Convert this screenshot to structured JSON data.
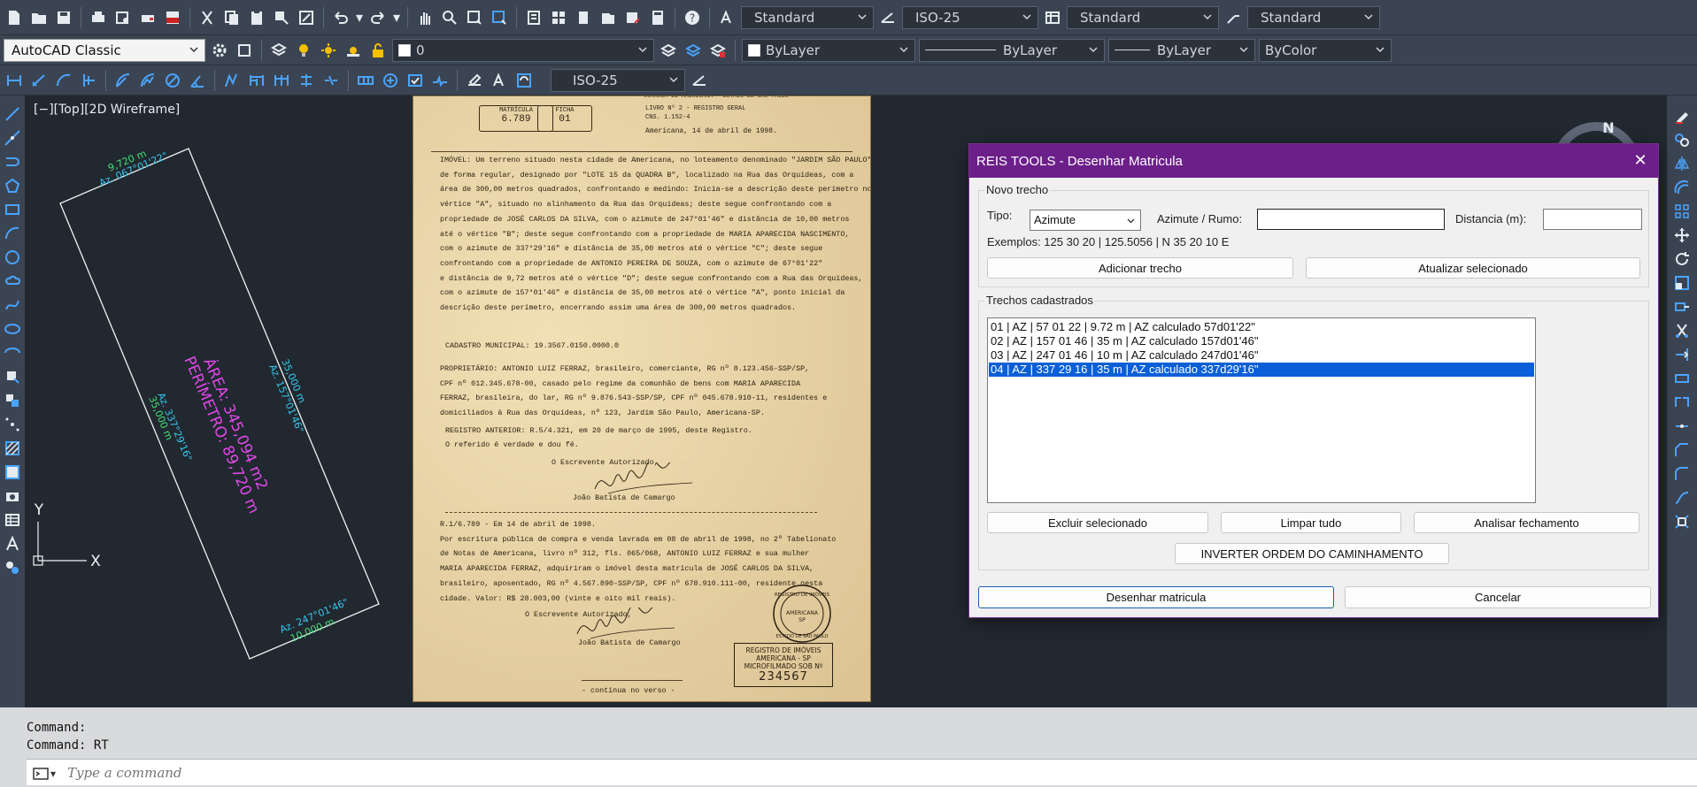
{
  "toolbar1": {
    "text_style": "Standard",
    "dim_style": "ISO-25",
    "table_style": "Standard",
    "multileader_style": "Standard"
  },
  "toolbar2": {
    "workspace": "AutoCAD Classic",
    "layer": "0",
    "color": "ByLayer",
    "linetype": "ByLayer",
    "lineweight": "ByLayer",
    "plotstyle": "ByColor"
  },
  "toolbar3": {
    "dim_style": "ISO-25"
  },
  "viewport": {
    "label": "[−][Top][2D Wireframe]",
    "compass_north": "N",
    "ucs_y": "Y",
    "ucs_x": "X",
    "drawing": {
      "seg1_len": "9,720 m",
      "seg1_az": "Az. 067°01'22\"",
      "seg2_len": "35,000 m",
      "seg2_az": "Az. 157°01'46\"",
      "seg3_len": "10,000 m",
      "seg3_az": "Az. 247°01'46\"",
      "seg4_len": "35,000 m",
      "seg4_az": "Az. 337°29'16\"",
      "area": "ÁREA: 345,094 m2",
      "perimeter": "PERÍMETRO: 89,720 m"
    }
  },
  "document": {
    "matricula_label": "MATRÍCULA",
    "matricula_value": "6.789",
    "ficha_label": "FICHA",
    "ficha_value": "01",
    "header_top": "COMARCA DE AMERICANA — ESTADO DE SÃO PAULO",
    "livro": "LIVRO Nº 2 - REGISTRO GERAL",
    "cns": "CNS. 1.152-4",
    "date": "Americana, 14 de abril de 1998.",
    "body_lines": [
      "IMÓVEL: Um terreno situado nesta cidade de Americana, no loteamento denominado \"JARDIM SÃO PAULO\",",
      "de forma regular, designado por \"LOTE 15 da QUADRA B\", localizado na Rua das Orquídeas, com a",
      "área de 300,00 metros quadrados, confrontando e medindo: Inicia-se a descrição deste perímetro no",
      "vértice \"A\", situado no alinhamento da Rua das Orquídeas; deste segue confrontando com a",
      "propriedade de JOSÉ CARLOS DA SILVA, com o azimute de 247°01'46\" e distância de 10,00 metros",
      "até o vértice \"B\"; deste segue confrontando com a propriedade de MARIA APARECIDA NASCIMENTO,",
      "com o azimute de 337°29'16\" e distância de 35,00 metros até o vértice \"C\"; deste segue",
      "confrontando com a propriedade de ANTONIO PEREIRA DE SOUZA, com o azimute de 67°01'22\"",
      "e distância de 9,72 metros até o vértice \"D\"; deste segue confrontando com a Rua das Orquídeas,",
      "com o azimute de 157°01'46\" e distância de 35,00 metros até o vértice \"A\", ponto inicial da",
      "descrição deste perímetro, encerrando assim uma área de 300,00 metros quadrados."
    ],
    "cadastro": "CADASTRO MUNICIPAL: 19.3567.0150.0000.0",
    "prop_lines": [
      "PROPRIETÁRIO: ANTONIO LUIZ FERRAZ, brasileiro, comerciante, RG nº 8.123.456-SSP/SP,",
      "CPF nº 012.345.678-00, casado pelo regime da comunhão de bens com MARIA APARECIDA",
      "FERRAZ, brasileira, do lar, RG nº 9.876.543-SSP/SP, CPF nº 045.678.910-11, residentes e",
      "domiciliados à Rua das Orquídeas, nº 123, Jardim São Paulo, Americana-SP."
    ],
    "registro_anterior": "REGISTRO ANTERIOR: R.5/4.321, em 20 de março de 1995, deste Registro.",
    "verdade": "O referido é verdade e dou fé.",
    "escrevente1": "O Escrevente Autorizado,",
    "signer1": "João Batista de Camargo",
    "r1_lines": [
      "R.1/6.789 - Em 14 de abril de 1998.",
      "Por escritura pública de compra e venda lavrada em 08 de abril de 1998, no 2º Tabelionato",
      "de Notas de Americana, livro nº 312, fls. 065/068, ANTONIO LUIZ FERRAZ e sua mulher",
      "MARIA APARECIDA FERRAZ, adquiriram o imóvel desta matrícula de JOSÉ CARLOS DA SILVA,",
      "brasileiro, aposentado, RG nº 4.567.890-SSP/SP, CPF nº 678.910.111-00, residente nesta",
      "cidade. Valor: R$ 28.003,00 (vinte e oito mil reais)."
    ],
    "escrevente2": "O Escrevente Autorizado,",
    "signer2": "João Batista de Camargo",
    "continua": "- continua no verso -",
    "seal_lines": [
      "REGISTRO DE IMÓVEIS",
      "AMERICANA",
      "SP",
      "ESTADO DE SÃO PAULO"
    ],
    "stamp_lines": [
      "REGISTRO DE IMÓVEIS",
      "AMERICANA - SP",
      "MICROFILMADO SOB Nº",
      "234567"
    ]
  },
  "dialog": {
    "title": "REIS TOOLS - Desenhar Matricula",
    "group_new": "Novo trecho",
    "tipo_label": "Tipo:",
    "tipo_value": "Azimute",
    "azimute_label": "Azimute / Rumo:",
    "azimute_value": "",
    "distancia_label": "Distancia (m):",
    "distancia_value": "",
    "examples": "Exemplos: 125 30 20 | 125.5056 | N 35 20 10 E",
    "add_button": "Adicionar trecho",
    "update_button": "Atualizar selecionado",
    "group_list": "Trechos cadastrados",
    "items": [
      "01 | AZ | 57 01 22 | 9.72 m | AZ calculado 57d01'22\"",
      "02 | AZ | 157 01 46 | 35 m | AZ calculado 157d01'46\"",
      "03 | AZ | 247 01 46 | 10 m | AZ calculado 247d01'46\"",
      "04 | AZ | 337 29 16 | 35 m | AZ calculado 337d29'16\""
    ],
    "delete_button": "Excluir selecionado",
    "clear_button": "Limpar tudo",
    "analyze_button": "Analisar fechamento",
    "invert_button": "INVERTER ORDEM DO CAMINHAMENTO",
    "draw_button": "Desenhar matricula",
    "cancel_button": "Cancelar"
  },
  "command": {
    "line1": "Command:",
    "line2": "Command: RT",
    "placeholder": "Type a command"
  }
}
